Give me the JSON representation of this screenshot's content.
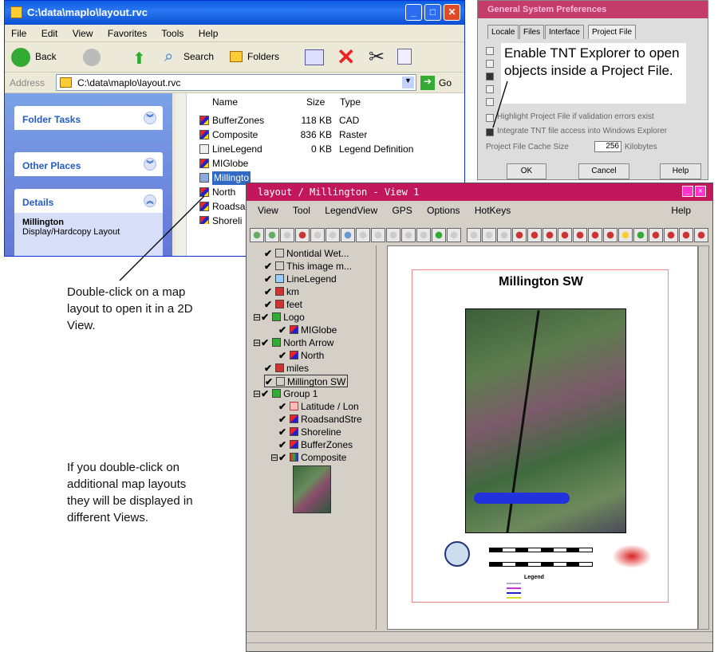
{
  "explorer": {
    "title": "C:\\data\\maplo\\layout.rvc",
    "menu": [
      "File",
      "Edit",
      "View",
      "Favorites",
      "Tools",
      "Help"
    ],
    "toolbar": {
      "back": "Back",
      "search": "Search",
      "folders": "Folders"
    },
    "address_label": "Address",
    "address_value": "C:\\data\\maplo\\layout.rvc",
    "go": "Go",
    "panels": [
      "Folder Tasks",
      "Other Places",
      "Details"
    ],
    "details_title": "Millington",
    "details_sub": "Display/Hardcopy Layout",
    "columns": [
      "Name",
      "Size",
      "Type"
    ],
    "files": [
      {
        "name": "BufferZones",
        "size": "118 KB",
        "type": "CAD"
      },
      {
        "name": "Composite",
        "size": "836 KB",
        "type": "Raster"
      },
      {
        "name": "LineLegend",
        "size": "0 KB",
        "type": "Legend Definition"
      },
      {
        "name": "MIGlobe",
        "size": "",
        "type": ""
      },
      {
        "name": "Millingto",
        "size": "",
        "type": ""
      },
      {
        "name": "North",
        "size": "",
        "type": ""
      },
      {
        "name": "Roadsa",
        "size": "",
        "type": ""
      },
      {
        "name": "Shoreli",
        "size": "",
        "type": ""
      }
    ]
  },
  "prefs": {
    "title": "General System Preferences",
    "tabs": [
      "Locale",
      "Files",
      "Interface",
      "Project File"
    ],
    "opt1": "Highlight Project File if validation errors exist",
    "opt2": "Integrate TNT file access into Windows Explorer",
    "cache_label": "Project File Cache Size",
    "cache_value": "256",
    "cache_unit": "Kilobytes",
    "buttons": [
      "OK",
      "Cancel",
      "Help"
    ]
  },
  "callout1": "Enable TNT Explorer to open objects inside a Project File.",
  "note1": "Double-click on a map layout to open it in a 2D View.",
  "note2": "If you double-click on additional map layouts they will be displayed in different Views.",
  "layout": {
    "title": "layout / Millington - View 1",
    "menu": [
      "View",
      "Tool",
      "LegendView",
      "GPS",
      "Options",
      "HotKeys"
    ],
    "help": "Help",
    "tree": [
      "Nontidal Wet...",
      "This image m...",
      "LineLegend",
      "km",
      "feet",
      "Logo",
      "MIGlobe",
      "North Arrow",
      "North",
      "miles",
      "Millington SW",
      "Group 1",
      "Latitude / Lon",
      "RoadsandStre",
      "Shoreline",
      "BufferZones",
      "Composite"
    ],
    "map_title": "Millington SW",
    "legend_title": "Legend"
  }
}
